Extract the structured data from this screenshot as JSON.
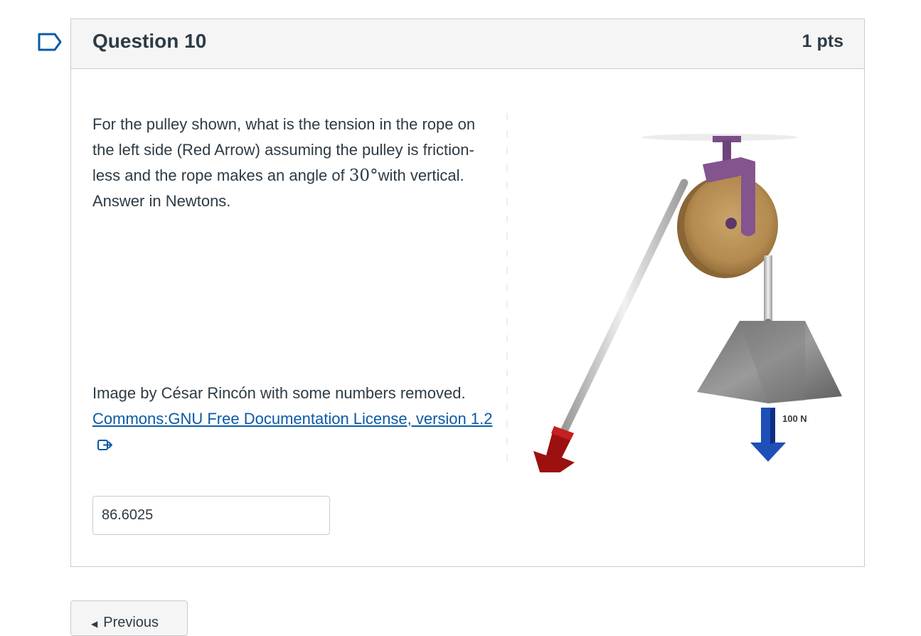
{
  "question": {
    "title": "Question 10",
    "points": "1 pts",
    "text_before_angle": "For the pulley shown, what is the tension in the rope on the left side (Red Arrow) assuming the pulley is friction-less and the rope makes an angle of ",
    "angle": "30°",
    "text_after_angle": "with vertical.  Answer in Newtons.",
    "credit_text": "Image by César Rincón with some numbers removed.",
    "license_link": "Commons:GNU Free Documentation License, version 1.2",
    "answer_value": "86.6025"
  },
  "figure": {
    "load_label": "100 N"
  },
  "nav": {
    "previous_label": "Previous"
  },
  "colors": {
    "link": "#0b5aa6",
    "header_bg": "#f5f5f5",
    "border": "#c7cdd1",
    "flag": "#0b5aa6"
  }
}
